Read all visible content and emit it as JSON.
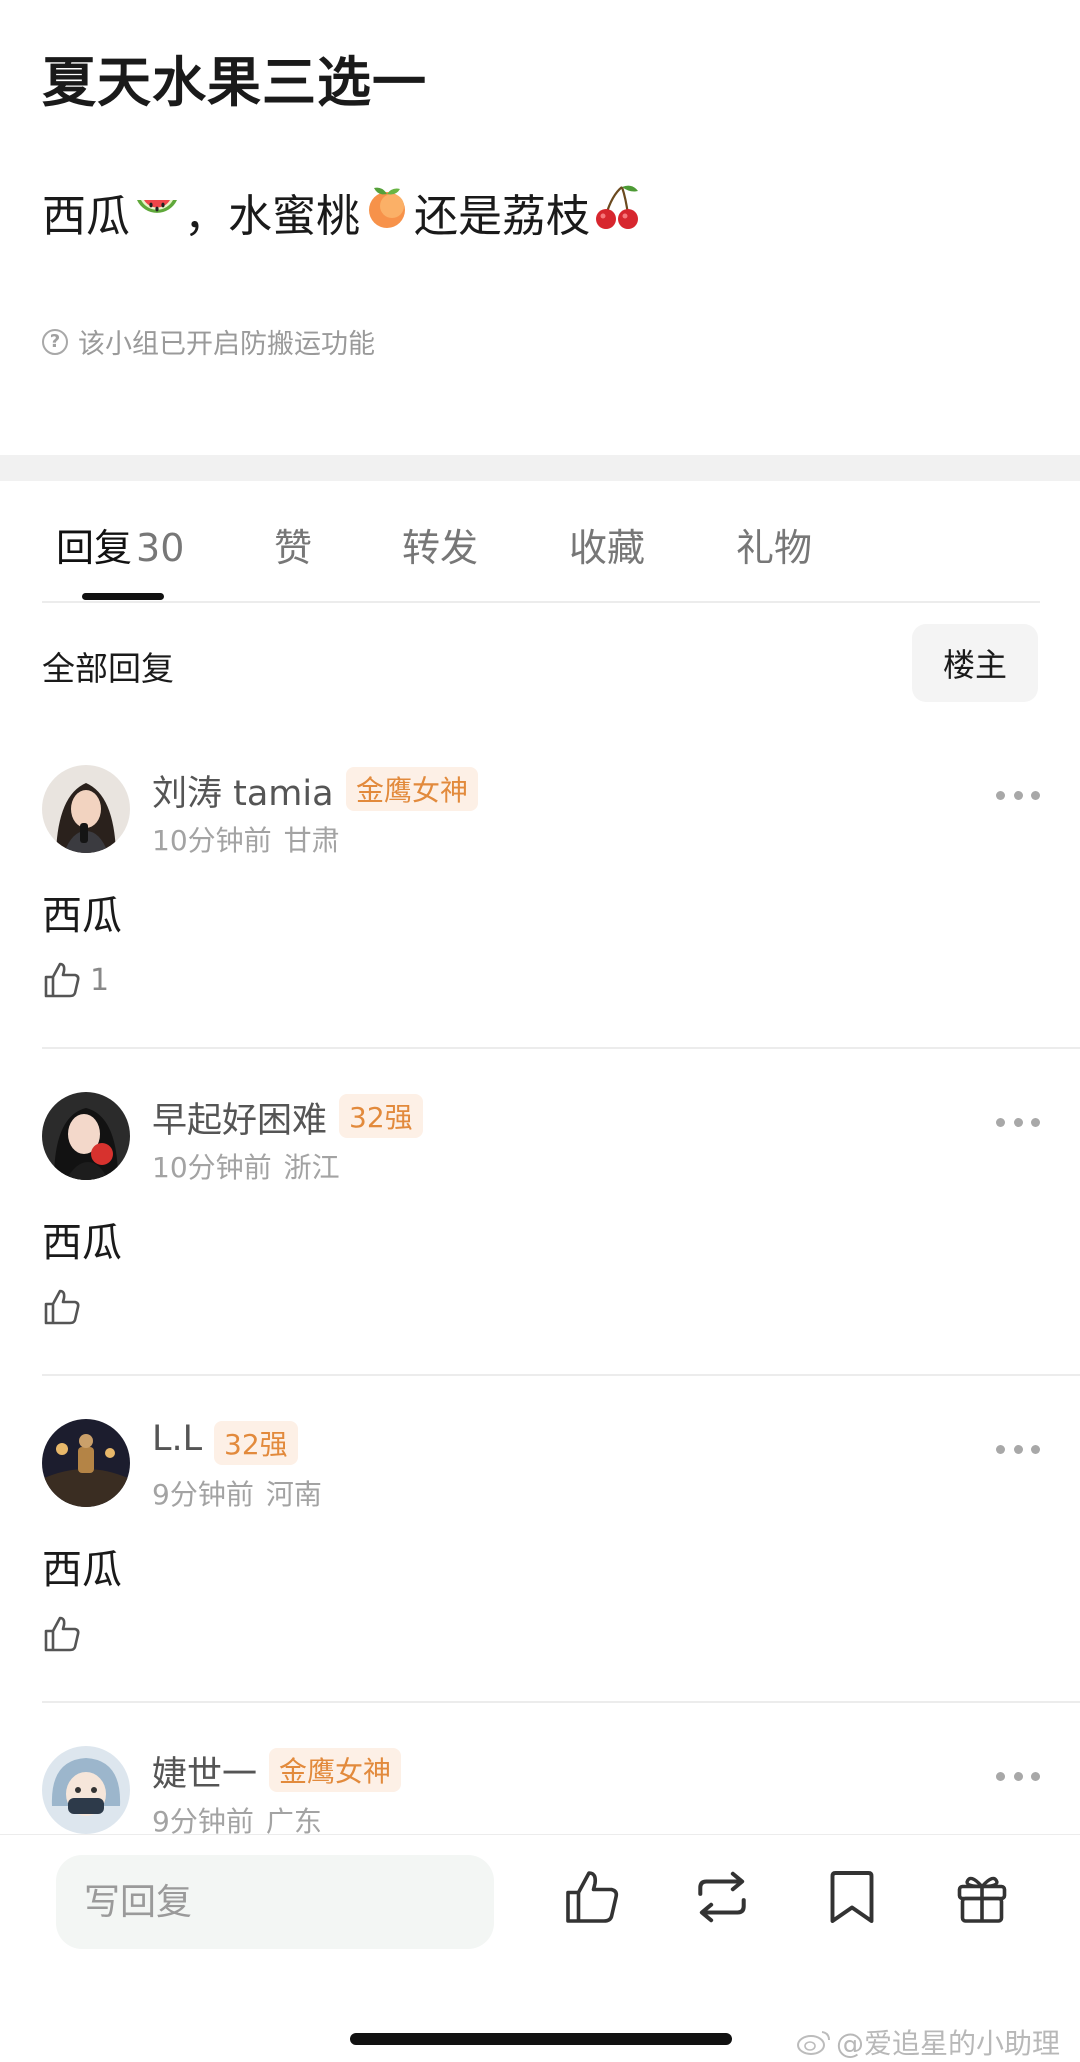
{
  "post": {
    "title": "夏天水果三选一",
    "body_part1": "西瓜",
    "body_part2": "，水蜜桃",
    "body_part3": "还是荔枝",
    "notice": "该小组已开启防搬运功能"
  },
  "tabs": [
    {
      "label": "回复",
      "count": "30"
    },
    {
      "label": "赞"
    },
    {
      "label": "转发"
    },
    {
      "label": "收藏"
    },
    {
      "label": "礼物"
    }
  ],
  "filter": {
    "title": "全部回复",
    "button": "楼主"
  },
  "comments": [
    {
      "name": "刘涛 tamia",
      "badge": "金鹰女神",
      "time": "10分钟前",
      "location": "甘肃",
      "text": "西瓜",
      "likes": "1"
    },
    {
      "name": "早起好困难",
      "badge": "32强",
      "time": "10分钟前",
      "location": "浙江",
      "text": "西瓜",
      "likes": ""
    },
    {
      "name": "L.L",
      "badge": "32强",
      "time": "9分钟前",
      "location": "河南",
      "text": "西瓜",
      "likes": ""
    },
    {
      "name": "婕世一",
      "badge": "金鹰女神",
      "time": "9分钟前",
      "location": "广东",
      "text": "",
      "likes": ""
    }
  ],
  "bottom_bar": {
    "reply_placeholder": "写回复"
  },
  "watermark": "@爱追星的小助理",
  "colors": {
    "badge_bg": "#fdf0e6",
    "badge_text": "#e28a3c",
    "separator_band": "#f1f1f1"
  }
}
